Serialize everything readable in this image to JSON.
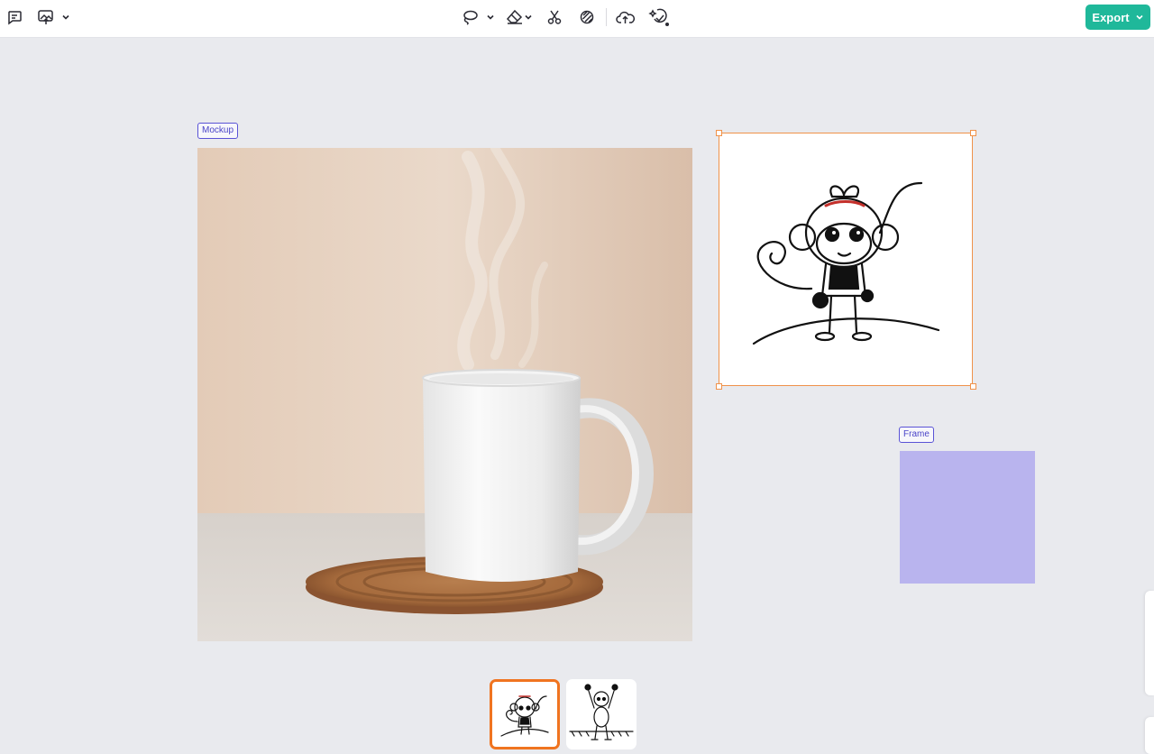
{
  "toolbar": {
    "left_icons": [
      "comment-icon",
      "upload-image-icon",
      "chevron-down-icon"
    ],
    "center_icons": [
      "lasso-icon",
      "chevron-down-icon",
      "eraser-icon",
      "chevron-down-icon",
      "cut-icon",
      "retouch-icon",
      "cloud-upscale-icon",
      "magic-enhance-icon"
    ],
    "export_label": "Export"
  },
  "canvas": {
    "mockup_label": "Mockup",
    "frame_label": "Frame",
    "frame_color": "#b9b4ee",
    "selection_color": "#f0924a"
  },
  "thumbnails": [
    {
      "name": "monkey-standing-thumbnail",
      "selected": true
    },
    {
      "name": "monkey-arms-up-thumbnail",
      "selected": false
    }
  ],
  "colors": {
    "accent": "#1fb89a",
    "canvas_bg": "#e9eaee",
    "thumb_selected": "#f07420"
  }
}
